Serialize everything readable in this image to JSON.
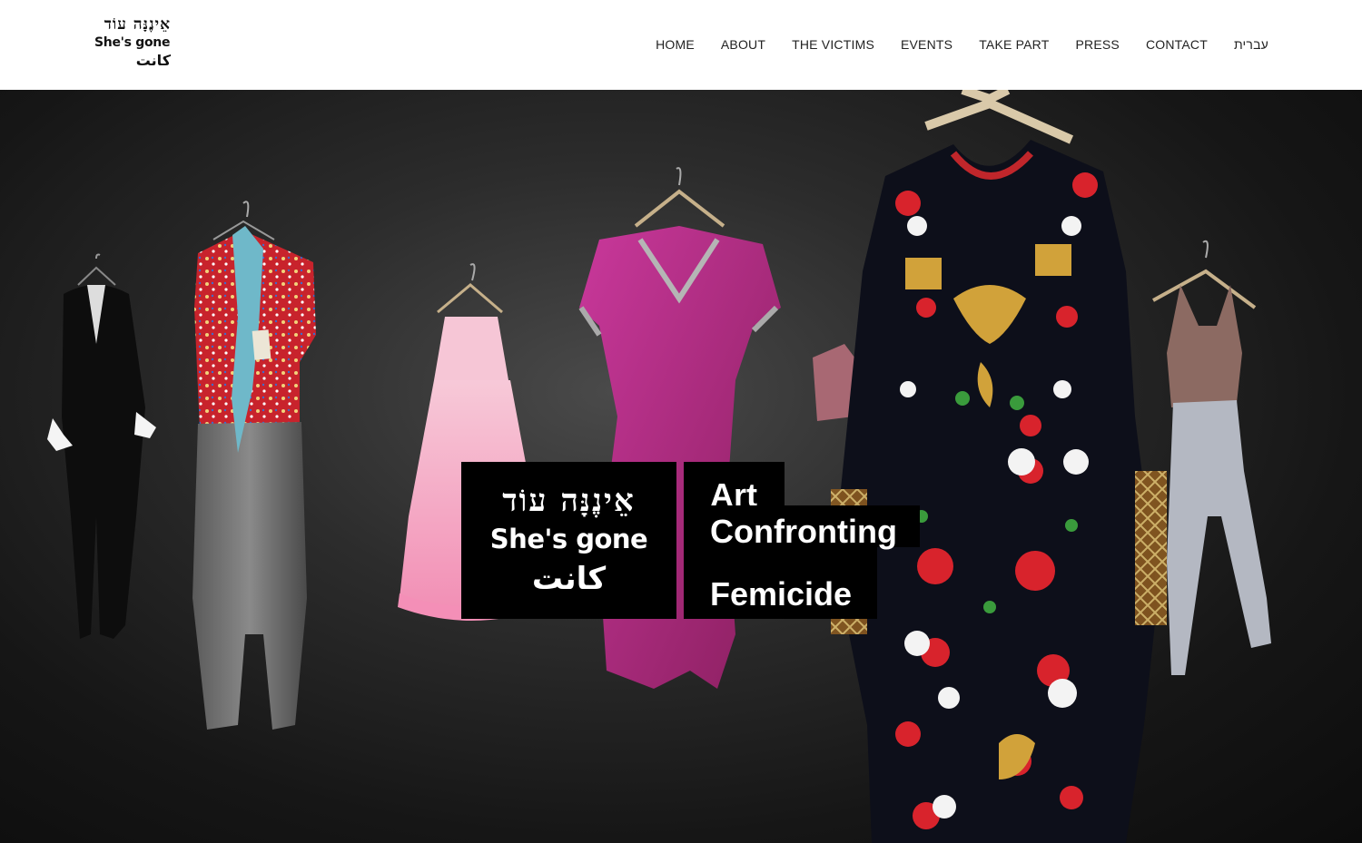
{
  "header": {
    "logo": {
      "hebrew": "אֵינֶנָּה עוֹד",
      "english": "She's gone",
      "arabic": "كانت"
    },
    "nav": [
      {
        "label": "HOME"
      },
      {
        "label": "ABOUT"
      },
      {
        "label": "THE VICTIMS"
      },
      {
        "label": "EVENTS"
      },
      {
        "label": "TAKE PART"
      },
      {
        "label": "PRESS"
      },
      {
        "label": "CONTACT"
      },
      {
        "label": "עברית"
      }
    ]
  },
  "hero": {
    "title": {
      "hebrew": "אֵינֶנָּה עוֹד",
      "english": "She's gone",
      "arabic": "كانت"
    },
    "tagline": {
      "line1": "Art",
      "line2": "Confronting",
      "line3": "Femicide"
    },
    "colors": {
      "box": "#000000",
      "text": "#ffffff",
      "background": "#1a1a1a"
    }
  }
}
